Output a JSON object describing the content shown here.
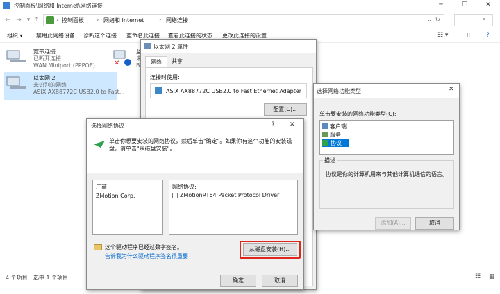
{
  "explorer": {
    "title": "控制面板\\网络和 Internet\\网络连接",
    "breadcrumb": [
      "控制面板",
      "网络和 Internet",
      "网络连接"
    ],
    "commands": [
      "组织 ▾",
      "禁用此网络设备",
      "诊断这个连接",
      "重命名此连接",
      "查看此连接的状态",
      "更改此连接的设置"
    ],
    "items": [
      {
        "name": "宽带连接",
        "status": "已断开连接",
        "device": "WAN Miniport (PPPOE)"
      },
      {
        "name": "以太网 2",
        "status": "未识别的网络",
        "device": "ASIX AX88772C USB2.0 to Fast..."
      },
      {
        "name": "蓝",
        "status": "未",
        "device": "B"
      }
    ],
    "status_count": "4 个项目",
    "status_selected": "选中 1 个项目"
  },
  "properties": {
    "title": "以太网 2 属性",
    "tabs": [
      "网络",
      "共享"
    ],
    "connect_using_label": "连接时使用:",
    "adapter": "ASIX AX88772C USB2.0 to Fast Ethernet Adapter",
    "configure_button": "配置(C)..."
  },
  "feature_type": {
    "title": "选择网络功能类型",
    "prompt": "单击要安装的网络功能类型(C):",
    "items": [
      "客户端",
      "服务",
      "协议"
    ],
    "description_title": "描述",
    "description": "协议是你的计算机用来与其他计算机通信的语言。",
    "add_button": "添加(A)...",
    "cancel_button": "取消"
  },
  "protocol": {
    "title": "选择网络协议",
    "help": "?",
    "close": "✕",
    "instruction": "单击你想要安装的网络协议，然后单击\"确定\"。如果你有这个功能的安装磁盘，请单击\"从磁盘安装\"。",
    "manufacturer_header": "厂商",
    "manufacturer": "ZMotion Corp.",
    "protocol_header": "网络协议:",
    "protocol_item": "ZMotionRT64 Packet Protocol Driver",
    "signed_note": "这个驱动程序已经过数字签名。",
    "signing_link": "告诉我为什么驱动程序签名很重要",
    "have_disk_button": "从磁盘安装(H)...",
    "ok_button": "确定",
    "cancel_button": "取消"
  },
  "colors": {
    "selection": "#cde8ff",
    "highlight": "#e0251b",
    "link": "#0066cc"
  }
}
